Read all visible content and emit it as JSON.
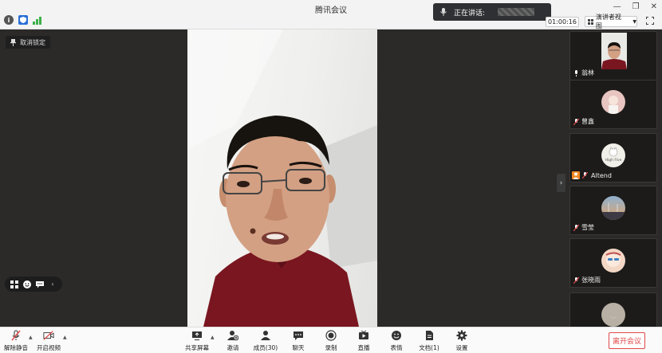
{
  "app": {
    "title": "腾讯会议"
  },
  "speaking": {
    "label": "正在讲话:"
  },
  "timer": {
    "value": "01:00:16"
  },
  "view_mode": {
    "label": "演讲者视图"
  },
  "pin": {
    "label": "取消锁定"
  },
  "participants": [
    {
      "name": "翁林",
      "type": "camera"
    },
    {
      "name": "曾鑫",
      "type": "avatar",
      "avatar_color": "#e8c5c0"
    },
    {
      "name": "Altend",
      "type": "avatar",
      "avatar_color": "#f0efe8",
      "avatar_text": "High Five",
      "status_icon": "person-orange-icon"
    },
    {
      "name": "雪莹",
      "type": "avatar",
      "avatar_color": "#6a8fb5"
    },
    {
      "name": "张晓雨",
      "type": "avatar",
      "avatar_color": "#f3d7c5"
    }
  ],
  "toolbar": {
    "unmute": "解除静音",
    "start_video": "开启视频",
    "share_screen": "共享屏幕",
    "invite": "邀请",
    "members": "成员(30)",
    "chat": "聊天",
    "record": "录制",
    "live": "直播",
    "reactions": "表情",
    "docs": "文档(1)",
    "settings": "设置",
    "leave": "离开会议"
  },
  "colors": {
    "leave": "#e04848",
    "signal": "#3cb04a",
    "shield": "#2a6fd6"
  }
}
